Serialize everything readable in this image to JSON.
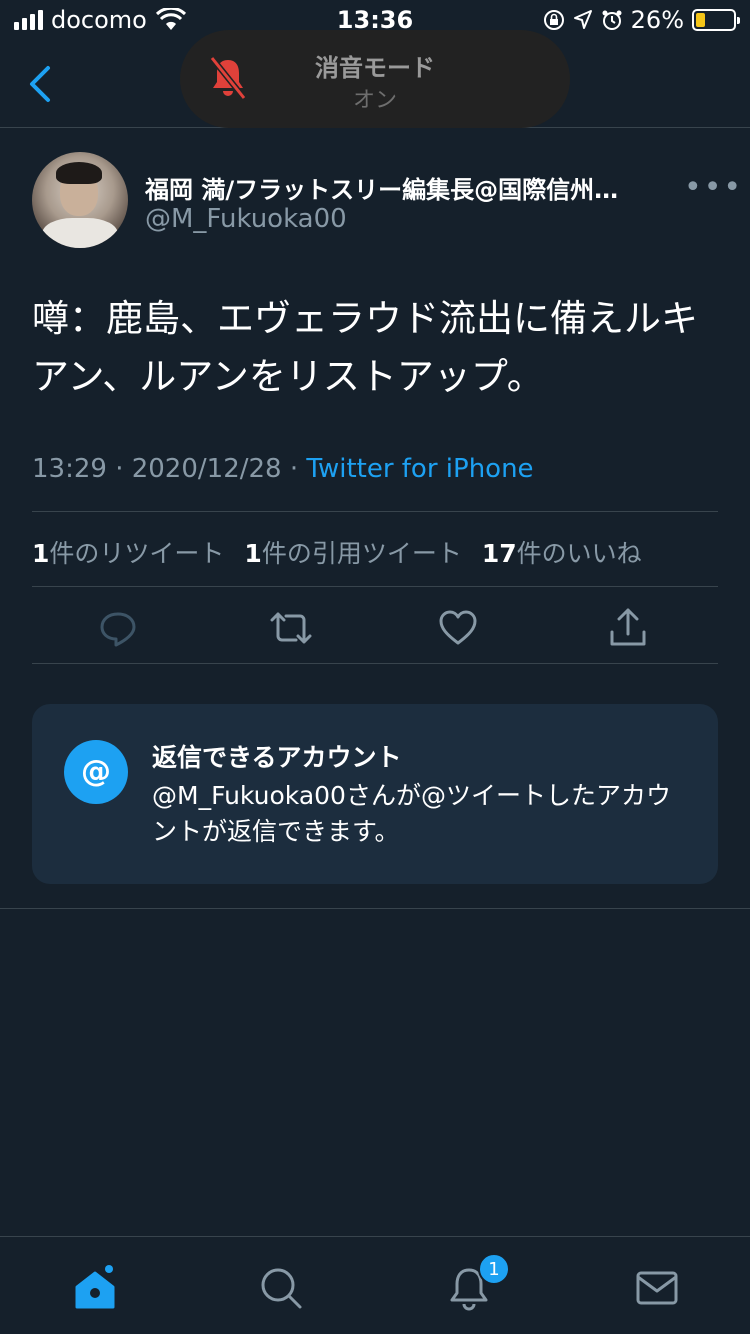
{
  "status_bar": {
    "carrier": "docomo",
    "time": "13:36",
    "battery": "26%",
    "battery_level": 0.26
  },
  "silent_mode": {
    "title": "消音モード",
    "state": "オン"
  },
  "tweet": {
    "author_name": "福岡 満/フラットスリー編集長@国際信州…",
    "author_handle": "@M_Fukuoka00",
    "more": "•••",
    "text": "噂：鹿島、エヴェラウド流出に備えルキアン、ルアンをリストアップ。",
    "timestamp": "13:29 · 2020/12/28 · ",
    "source": "Twitter for iPhone",
    "retweets_count": "1",
    "retweets_label": "件のリツイート",
    "quotes_count": "1",
    "quotes_label": "件の引用ツイート",
    "likes_count": "17",
    "likes_label": "件のいいね"
  },
  "reply_card": {
    "icon_text": "@",
    "title": "返信できるアカウント",
    "body": "@M_Fukuoka00さんが@ツイートしたアカウントが返信できます。"
  },
  "tabbar": {
    "notifications_badge": "1"
  },
  "colors": {
    "background": "#15202b",
    "accent": "#1da1f2",
    "secondary_text": "#8899a6",
    "divider": "#38444d",
    "card": "#1c2d3e",
    "silent_bell": "#e0413a"
  }
}
